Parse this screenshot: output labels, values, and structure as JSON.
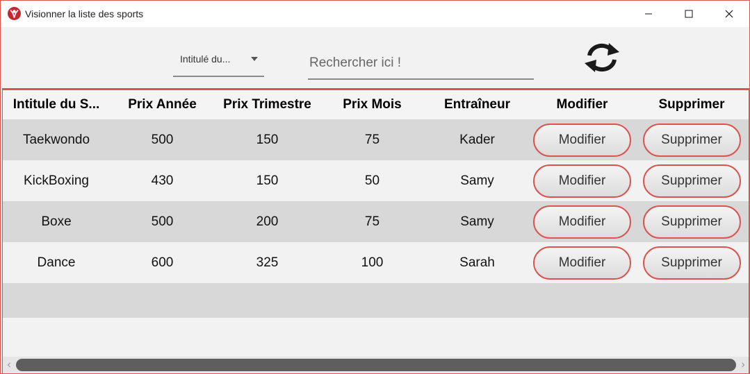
{
  "window": {
    "title": "Visionner la liste des sports",
    "accent_color": "#d9534f",
    "icon": "app-logo-icon"
  },
  "toolbar": {
    "filter_select_value": "Intitulé du...",
    "search_placeholder": "Rechercher ici !",
    "refresh_icon": "refresh-icon"
  },
  "table": {
    "headers": [
      "Intitule du S...",
      "Prix Année",
      "Prix Trimestre",
      "Prix Mois",
      "Entraîneur",
      "Modifier",
      "Supprimer"
    ],
    "rows": [
      {
        "name": "Taekwondo",
        "year": "500",
        "quarter": "150",
        "month": "75",
        "coach": "Kader",
        "edit": "Modifier",
        "delete": "Supprimer"
      },
      {
        "name": "KickBoxing",
        "year": "430",
        "quarter": "150",
        "month": "50",
        "coach": "Samy",
        "edit": "Modifier",
        "delete": "Supprimer"
      },
      {
        "name": "Boxe",
        "year": "500",
        "quarter": "200",
        "month": "75",
        "coach": "Samy",
        "edit": "Modifier",
        "delete": "Supprimer"
      },
      {
        "name": "Dance",
        "year": "600",
        "quarter": "325",
        "month": "100",
        "coach": "Sarah",
        "edit": "Modifier",
        "delete": "Supprimer"
      }
    ]
  }
}
